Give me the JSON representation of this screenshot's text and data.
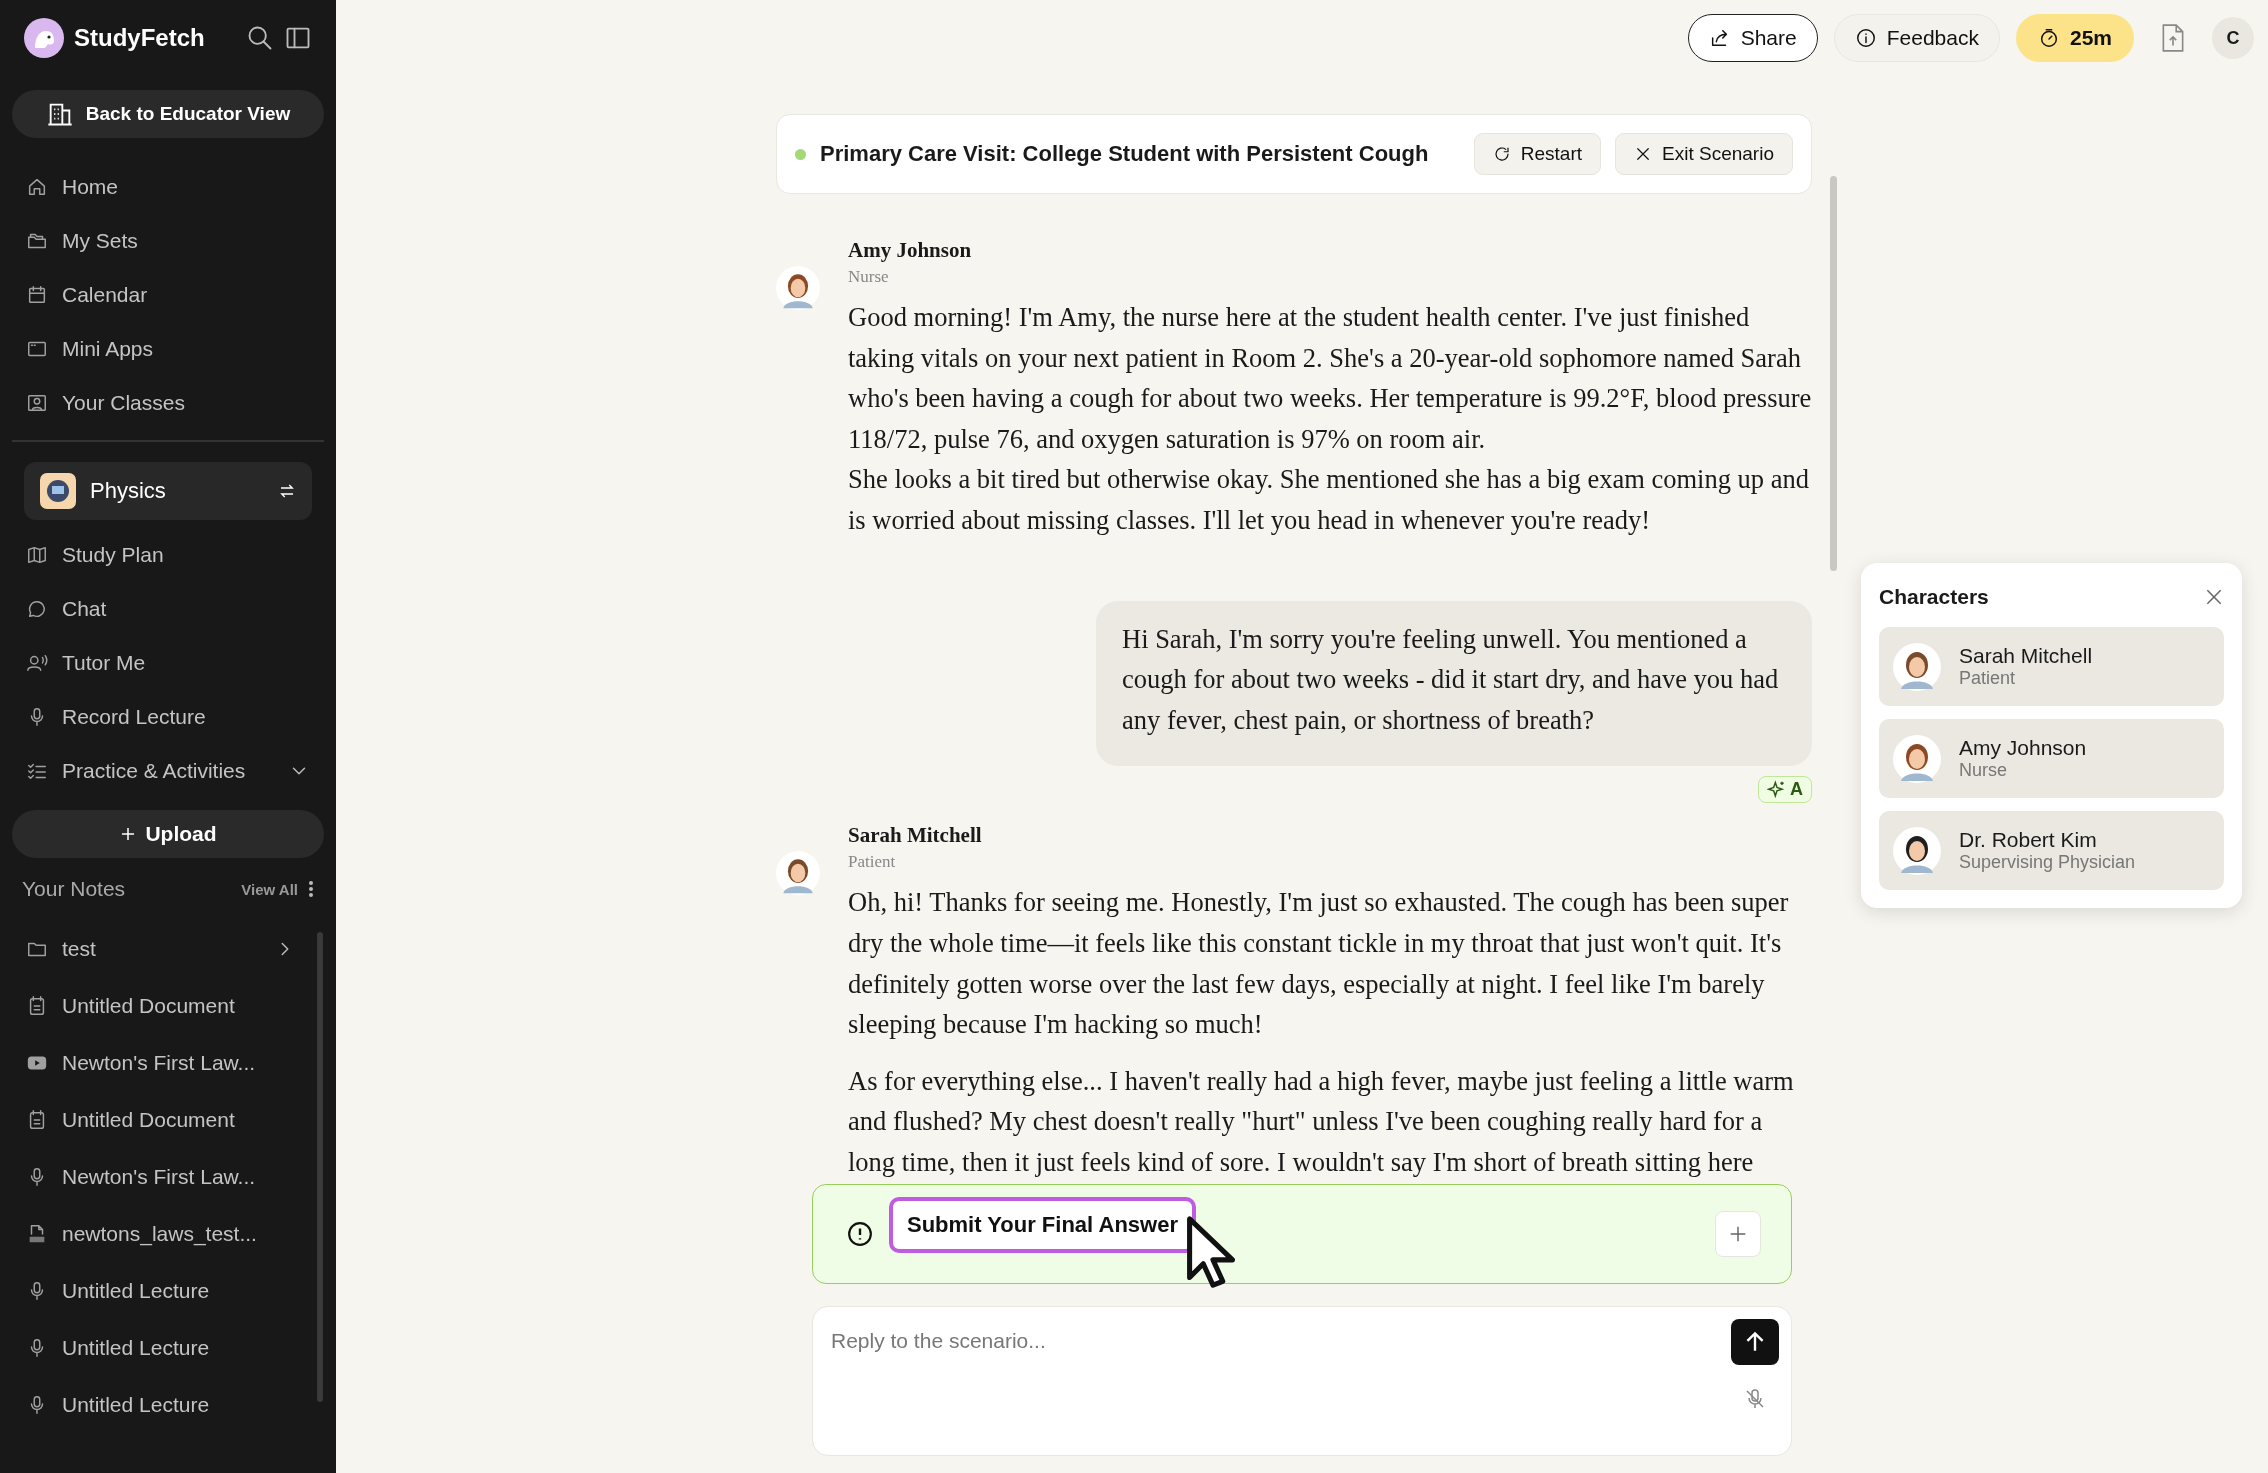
{
  "sidebar": {
    "brand": "StudyFetch",
    "back_button": "Back to Educator View",
    "nav": [
      {
        "label": "Home",
        "kind": "home"
      },
      {
        "label": "My Sets",
        "kind": "folders"
      },
      {
        "label": "Calendar",
        "kind": "calendar"
      },
      {
        "label": "Mini Apps",
        "kind": "window"
      },
      {
        "label": "Your Classes",
        "kind": "classes"
      }
    ],
    "course": {
      "name": "Physics"
    },
    "course_nav": [
      {
        "label": "Study Plan",
        "kind": "map"
      },
      {
        "label": "Chat",
        "kind": "chat"
      },
      {
        "label": "Tutor Me",
        "kind": "tutor"
      },
      {
        "label": "Record Lecture",
        "kind": "mic"
      },
      {
        "label": "Practice & Activities",
        "kind": "checklist",
        "expanded": false
      }
    ],
    "upload": "Upload",
    "notes_heading": "Your Notes",
    "view_all": "View All",
    "notes": [
      {
        "label": "test",
        "kind": "folder"
      },
      {
        "label": "Untitled Document",
        "kind": "document"
      },
      {
        "label": "Newton's First Law...",
        "kind": "video"
      },
      {
        "label": "Untitled Document",
        "kind": "document"
      },
      {
        "label": "Newton's First Law...",
        "kind": "mic"
      },
      {
        "label": "newtons_laws_test...",
        "kind": "pdf"
      },
      {
        "label": "Untitled Lecture",
        "kind": "mic"
      },
      {
        "label": "Untitled Lecture",
        "kind": "mic"
      },
      {
        "label": "Untitled Lecture",
        "kind": "mic"
      }
    ]
  },
  "topbar": {
    "share": "Share",
    "feedback": "Feedback",
    "timer": "25m",
    "avatar": "C"
  },
  "scenario": {
    "title": "Primary Care Visit: College Student with Persistent Cough",
    "active": true,
    "restart": "Restart",
    "exit": "Exit Scenario"
  },
  "messages": [
    {
      "kind": "character",
      "name": "Amy Johnson",
      "role": "Nurse",
      "paragraphs": [
        "Good morning! I'm Amy, the nurse here at the student health center. I've just finished taking vitals on your next patient in Room 2. She's a 20-year-old sophomore named Sarah who's been having a cough for about two weeks. Her temperature is 99.2°F, blood pressure 118/72, pulse 76, and oxygen saturation is 97% on room air.\nShe looks a bit tired but otherwise okay. She mentioned she has a big exam coming up and is worried about missing classes. I'll let you head in whenever you're ready!"
      ]
    },
    {
      "kind": "user",
      "paragraphs": [
        "Hi Sarah, I'm sorry you're feeling unwell. You mentioned a cough for about two weeks - did it start dry, and have you had any fever, chest pain, or shortness of breath?"
      ],
      "badge": "A"
    },
    {
      "kind": "character",
      "name": "Sarah Mitchell",
      "role": "Patient",
      "paragraphs": [
        "Oh, hi! Thanks for seeing me. Honestly, I'm just so exhausted. The cough has been super dry the whole time—it feels like this constant tickle in my throat that just won't quit. It's definitely gotten worse over the last few days, especially at night. I feel like I'm barely sleeping because I'm hacking so much!",
        "As for everything else... I haven't really had a high fever, maybe just feeling a little warm and flushed? My chest doesn't really \"hurt\" unless I've been coughing really hard for a long time, then it just feels kind of sore. I wouldn't say I'm short of breath sitting here"
      ]
    }
  ],
  "final_answer": {
    "label": "Submit Your Final Answer"
  },
  "reply": {
    "placeholder": "Reply to the scenario..."
  },
  "characters": {
    "title": "Characters",
    "items": [
      {
        "name": "Sarah Mitchell",
        "role": "Patient"
      },
      {
        "name": "Amy Johnson",
        "role": "Nurse"
      },
      {
        "name": "Dr. Robert Kim",
        "role": "Supervising Physician"
      }
    ]
  }
}
